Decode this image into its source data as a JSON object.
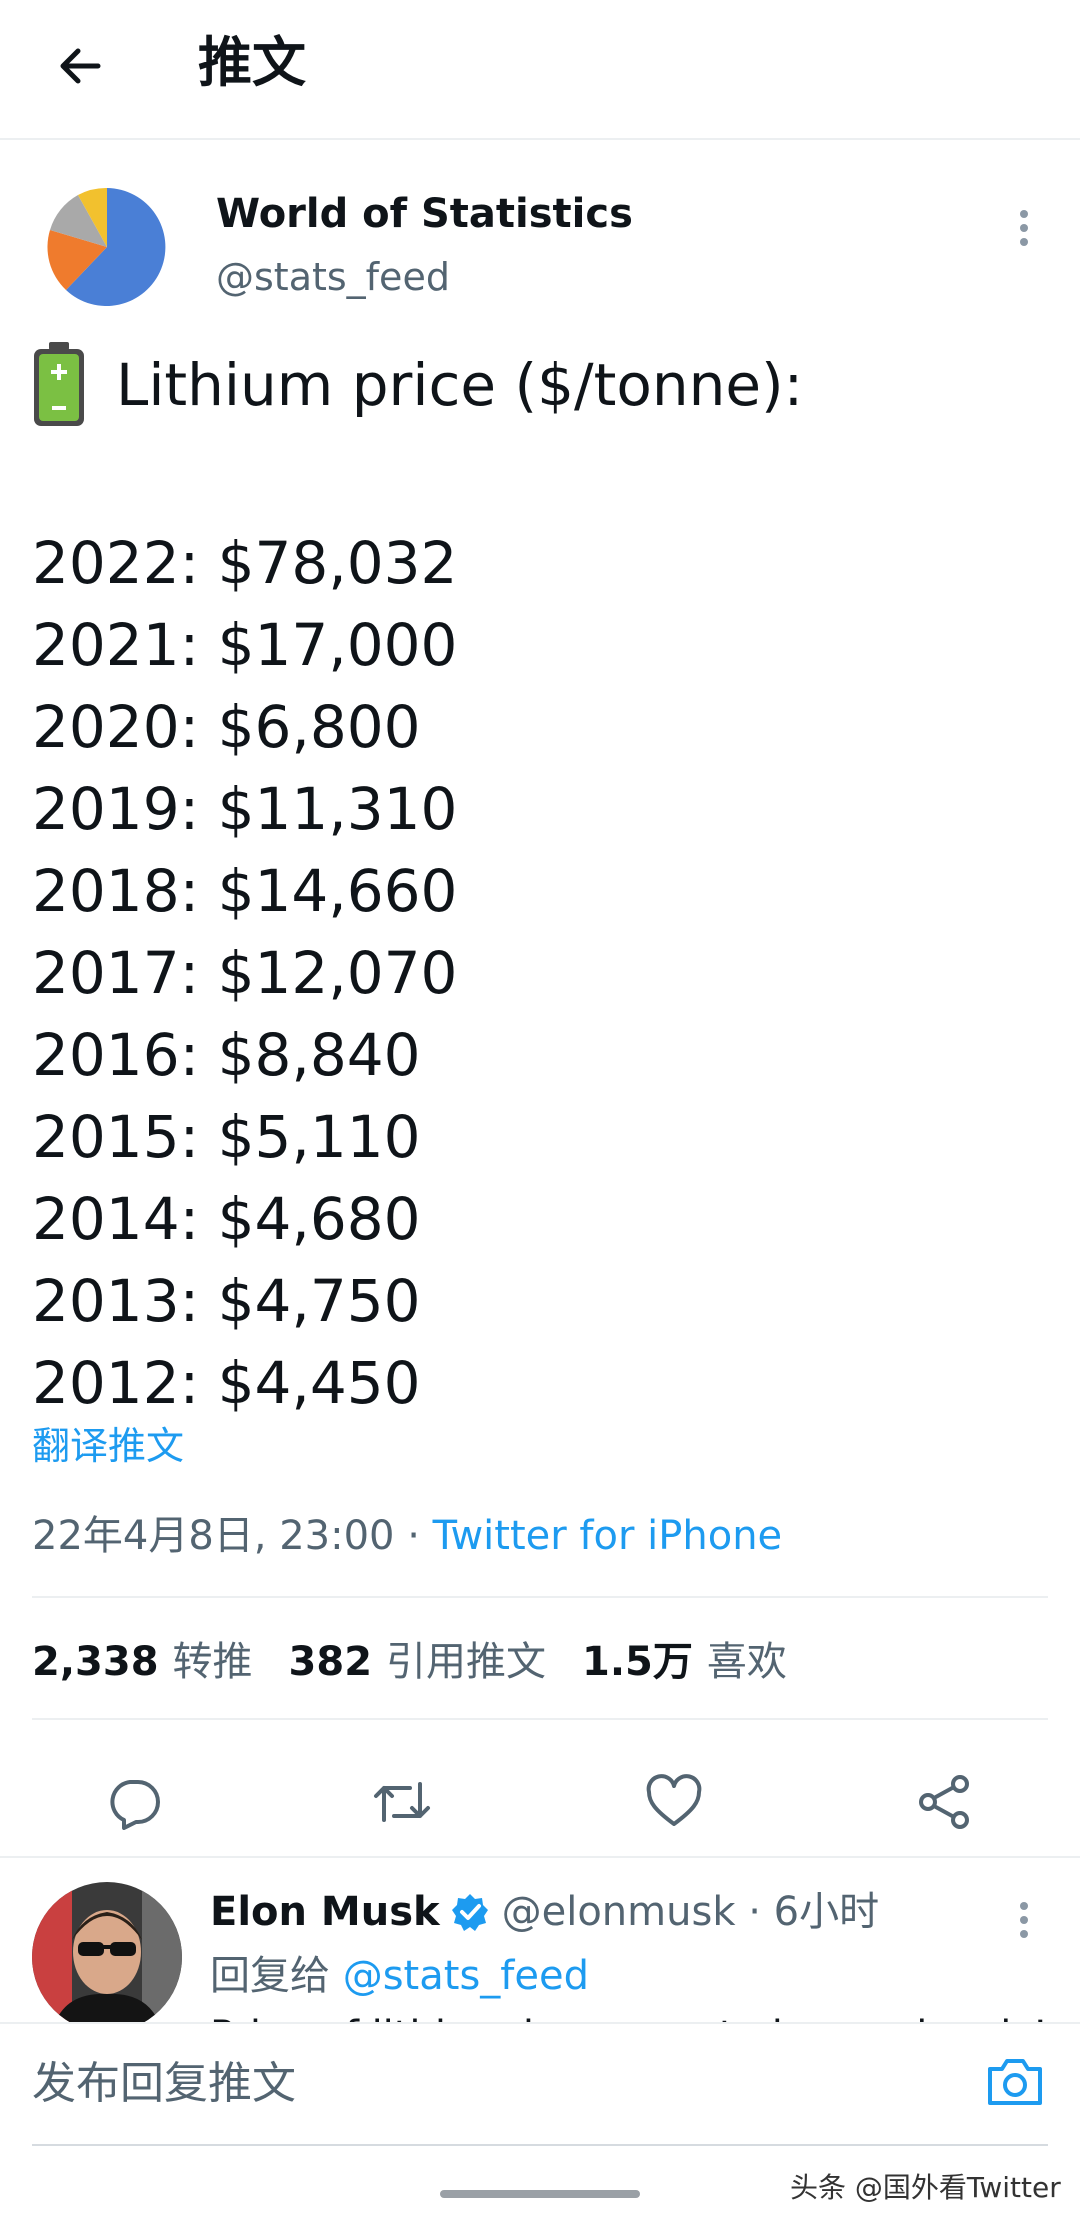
{
  "header": {
    "title": "推文",
    "back_icon": "arrow-left-icon"
  },
  "tweet": {
    "author": {
      "name": "World of Statistics",
      "handle": "@stats_feed",
      "avatar_colors": [
        "#4a7fd6",
        "#ef7b2d",
        "#a9a9a9",
        "#f2c12e"
      ]
    },
    "headline_emoji": "battery-icon",
    "headline": "Lithium price ($/tonne):",
    "prices": [
      "2022: $78,032",
      "2021: $17,000",
      "2020: $6,800",
      "2019: $11,310",
      "2018: $14,660",
      "2017: $12,070",
      "2016: $8,840",
      "2015: $5,110",
      "2014: $4,680",
      "2013: $4,750",
      "2012: $4,450"
    ],
    "translate_label": "翻译推文",
    "timestamp": "22年4月8日, 23:00 ·",
    "source": "Twitter for iPhone",
    "stats": {
      "retweets_count": "2,338",
      "retweets_label": "转推",
      "quotes_count": "382",
      "quotes_label": "引用推文",
      "likes_count": "1.5万",
      "likes_label": "喜欢"
    },
    "actions": [
      "reply-icon",
      "retweet-icon",
      "like-icon",
      "share-icon"
    ]
  },
  "reply": {
    "name": "Elon Musk",
    "handle": "@elonmusk · 6小时",
    "reply_to_prefix": "回复给",
    "reply_to_mention": "@stats_feed",
    "text_preview": "Price of lithium has gone to insane levels!"
  },
  "composer": {
    "placeholder": "发布回复推文",
    "camera_icon": "camera-icon"
  },
  "watermark": "头条 @国外看Twitter",
  "colors": {
    "accent": "#1d9bf0",
    "text": "#0f1419",
    "secondary": "#536471",
    "divider": "#eceff1"
  }
}
